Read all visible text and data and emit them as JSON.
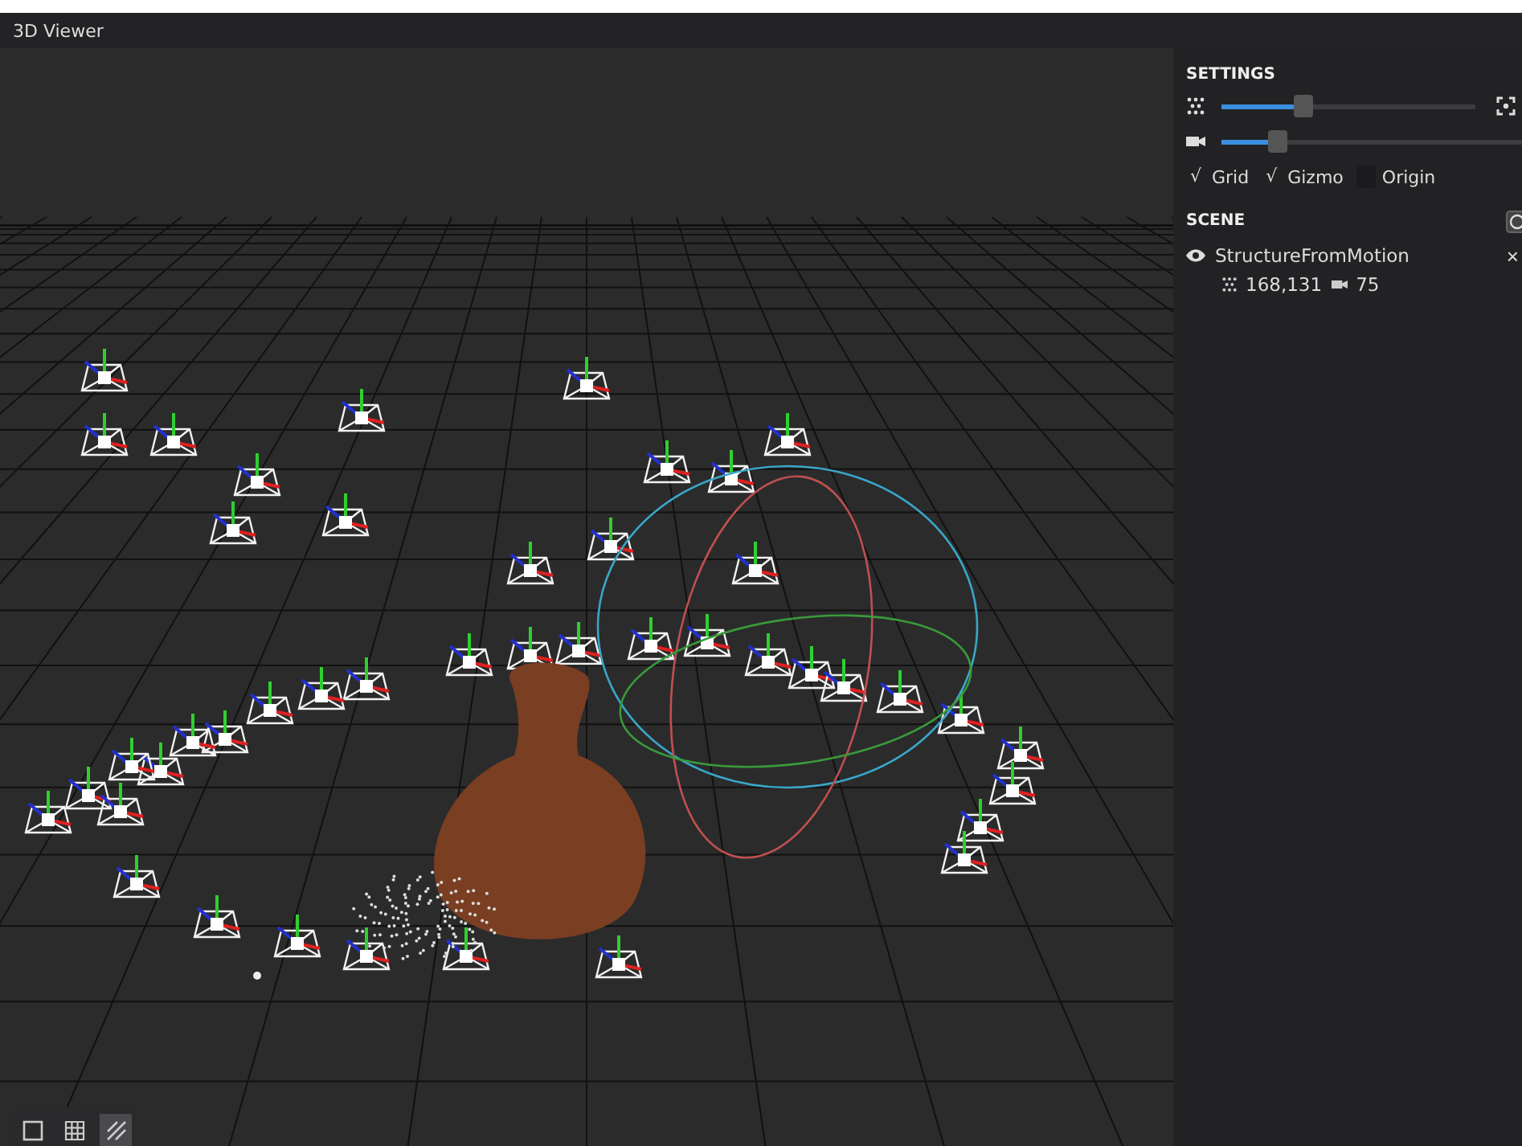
{
  "window": {
    "title": "3D Viewer"
  },
  "settings": {
    "title": "SETTINGS",
    "check_glyph": "√",
    "sliders": [
      {
        "kind": "points",
        "level": 0.32
      },
      {
        "kind": "camera",
        "level": 0.17
      }
    ],
    "toggles": [
      {
        "label": "Grid",
        "checked": true
      },
      {
        "label": "Gizmo",
        "checked": true
      },
      {
        "label": "Origin",
        "checked": false
      }
    ]
  },
  "scene": {
    "title": "SCENE",
    "items": [
      {
        "name": "StructureFromMotion",
        "visible": true,
        "points": "168,131",
        "cameras": "75",
        "remove_glyph": "×"
      }
    ]
  },
  "view_modes": [
    {
      "kind": "solid",
      "selected": false
    },
    {
      "kind": "wireframe",
      "selected": false
    },
    {
      "kind": "textured",
      "selected": true
    }
  ]
}
